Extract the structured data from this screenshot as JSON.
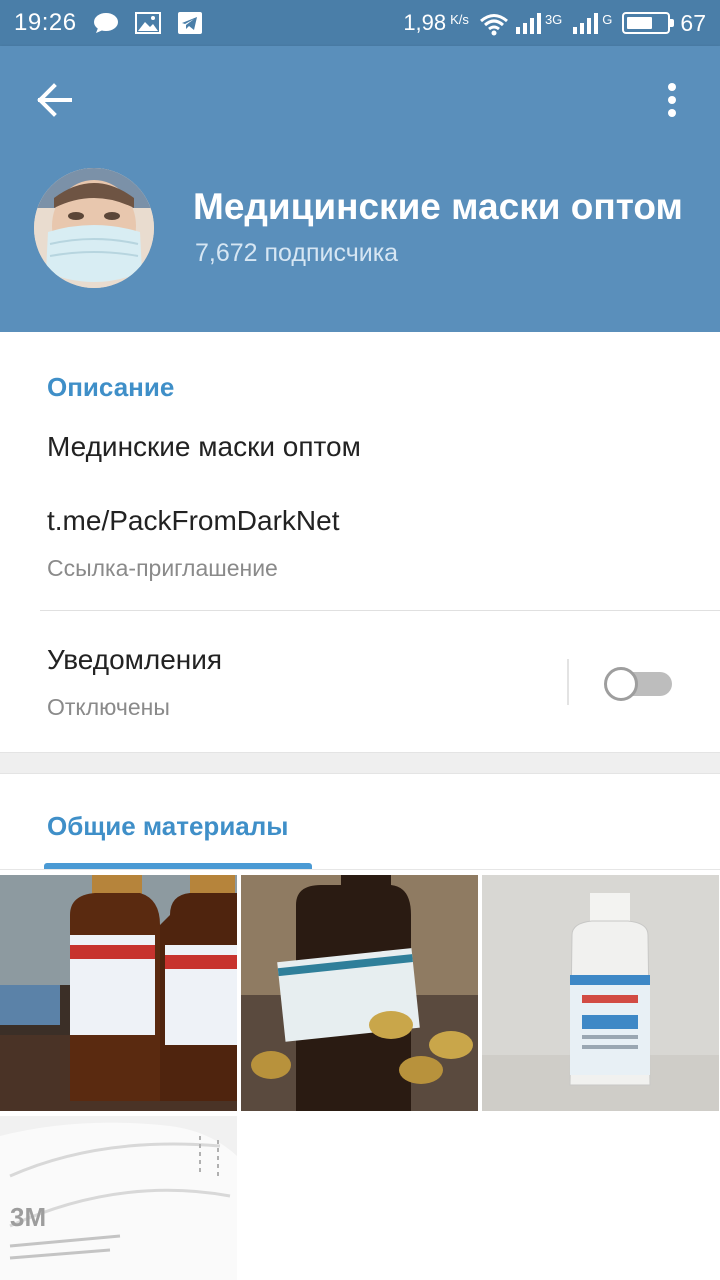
{
  "status_bar": {
    "time": "19:26",
    "speed": "1,98",
    "speed_unit": "K/s",
    "net1": "3G",
    "net2": "G",
    "battery": "67",
    "icons": [
      "chat-bubble-icon",
      "image-icon",
      "telegram-icon",
      "wifi-icon",
      "signal-icon",
      "battery-icon"
    ]
  },
  "header": {
    "title": "Медицинские маски оптом",
    "subscribers": "7,672 подписчика",
    "icons": [
      "back-arrow-icon",
      "more-vert-icon"
    ]
  },
  "info": {
    "section_title": "Описание",
    "description": "Мединские маски оптом",
    "link": "t.me/PackFromDarkNet",
    "link_caption": "Ссылка-приглашение",
    "notifications_label": "Уведомления",
    "notifications_status": "Отключены",
    "notifications_enabled": false
  },
  "media": {
    "tab_label": "Общие материалы",
    "items": [
      {
        "name": "antiseptic-bottles-photo"
      },
      {
        "name": "antiseptic-bottle-closeup-photo"
      },
      {
        "name": "plastic-bottle-photo"
      },
      {
        "name": "respirator-mask-photo",
        "label": "3M"
      }
    ]
  },
  "colors": {
    "status_bar": "#4a7ea8",
    "header": "#5a8fbb",
    "accent": "#3f8fc8"
  }
}
